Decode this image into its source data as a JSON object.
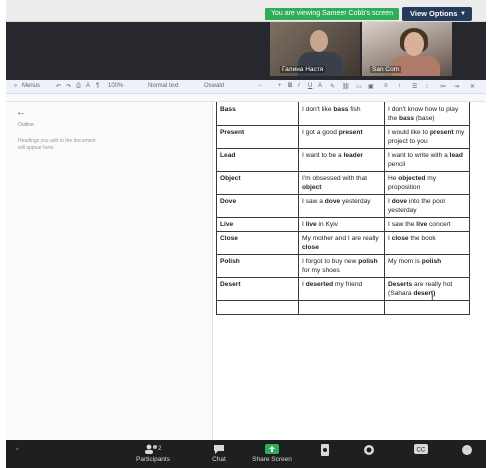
{
  "zoom": {
    "share_banner": "You are viewing Sameer Cobb's screen",
    "view_options": "View Options",
    "participants": [
      {
        "name": "Галина Настя"
      },
      {
        "name": "San Com"
      }
    ],
    "participant_count": "2",
    "bottom_bar": {
      "participants": "Participants",
      "chat": "Chat",
      "share": "Share Screen"
    }
  },
  "docs": {
    "toolbar": {
      "menus": "Menus",
      "zoom": "100%",
      "style": "Normal text",
      "font": "Oswald"
    },
    "outline": {
      "title": "Outline",
      "hint": "Headings you add to the document will appear here."
    },
    "table": {
      "rows": [
        {
          "word": "Bass",
          "example_1": "I don't like bass fish",
          "example_2": "I don't know how to play the bass (base)"
        },
        {
          "word": "Present",
          "example_1": "I got a good present",
          "example_2": "I would like to present my project to you"
        },
        {
          "word": "Lead",
          "example_1": "I want to be a leader",
          "example_2": "I want to write with a lead pencil"
        },
        {
          "word": "Object",
          "example_1": "I'm obsessed with that object",
          "example_2": "He objected my proposition"
        },
        {
          "word": "Dove",
          "example_1": "I saw a dove yesterday",
          "example_2": "I dove into the pool yesterday"
        },
        {
          "word": "Live",
          "example_1": "I live in Kyiv",
          "example_2": "I saw the live concert"
        },
        {
          "word": "Close",
          "example_1": "My mother and I are really close",
          "example_2": "I close the book"
        },
        {
          "word": "Polish",
          "example_1": "I forgot to buy new polish for my shoes",
          "example_2": "My mom is polish"
        },
        {
          "word": "Desert",
          "example_1": "I deserted my friend",
          "example_2": "Deserts are really hot (Sahara desert)"
        }
      ]
    }
  },
  "colors": {
    "banner_green": "#2fae5a",
    "view_options_bg": "#263a5a",
    "zoom_bar_bg": "#1f1f21"
  }
}
